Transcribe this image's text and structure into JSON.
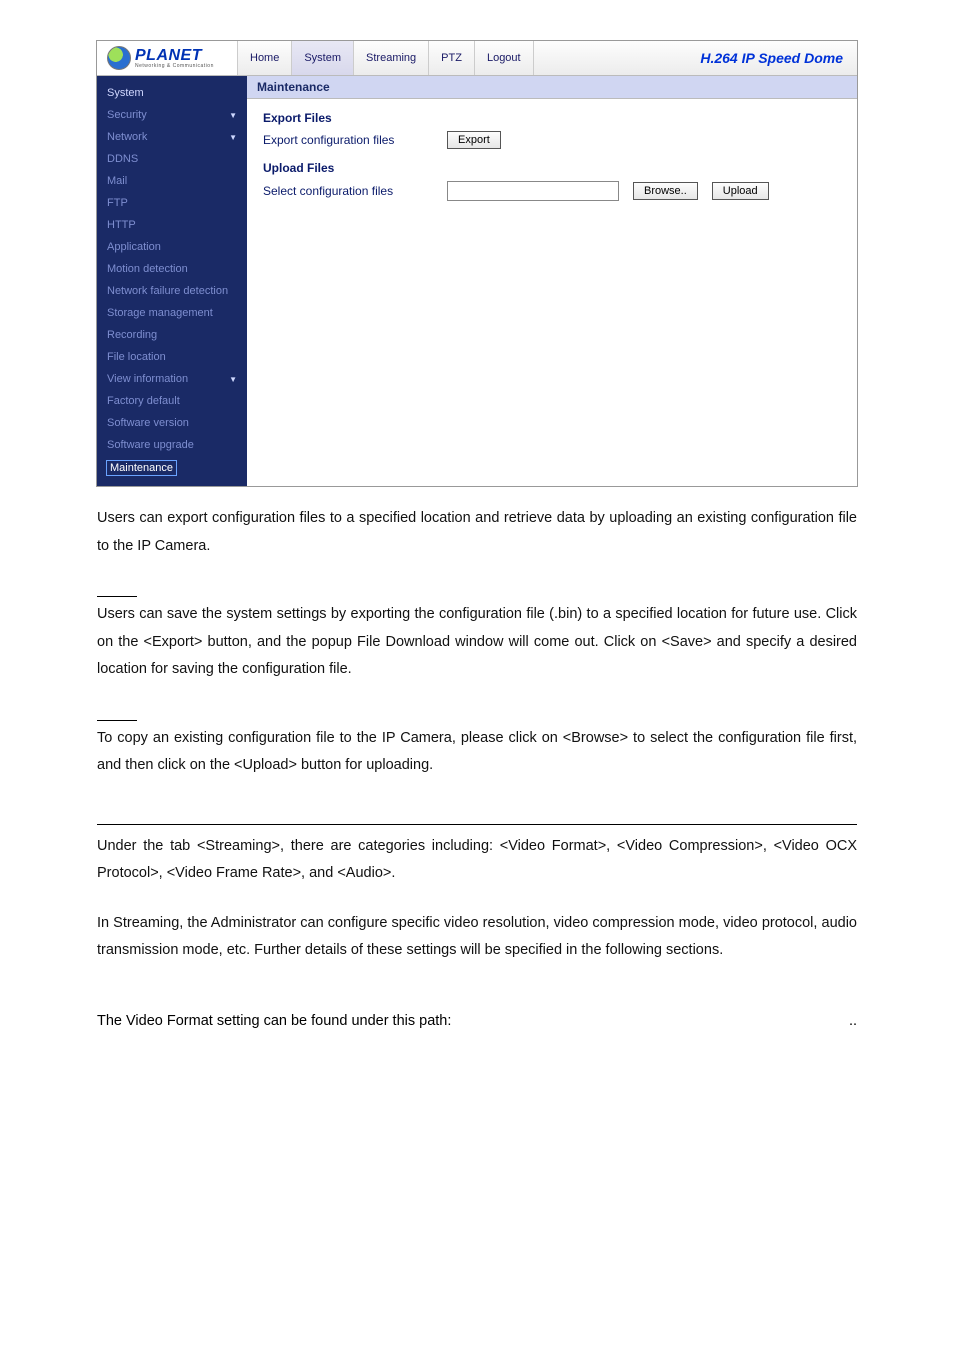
{
  "app": {
    "logo_text": "PLANET",
    "logo_sub": "Networking & Communication",
    "tabs": [
      "Home",
      "System",
      "Streaming",
      "PTZ",
      "Logout"
    ],
    "active_tab_index": 1,
    "brand_right": "H.264 IP Speed Dome"
  },
  "sidebar": {
    "items": [
      {
        "label": "System",
        "dim": false,
        "caret": false
      },
      {
        "label": "Security",
        "dim": true,
        "caret": true
      },
      {
        "label": "Network",
        "dim": true,
        "caret": true
      },
      {
        "label": "DDNS",
        "dim": true,
        "caret": false
      },
      {
        "label": "Mail",
        "dim": true,
        "caret": false
      },
      {
        "label": "FTP",
        "dim": true,
        "caret": false
      },
      {
        "label": "HTTP",
        "dim": true,
        "caret": false
      },
      {
        "label": "Application",
        "dim": true,
        "caret": false
      },
      {
        "label": "Motion detection",
        "dim": true,
        "caret": false
      },
      {
        "label": "Network failure detection",
        "dim": true,
        "caret": false
      },
      {
        "label": "Storage management",
        "dim": true,
        "caret": false
      },
      {
        "label": "Recording",
        "dim": true,
        "caret": false
      },
      {
        "label": "File location",
        "dim": true,
        "caret": false
      },
      {
        "label": "View information",
        "dim": true,
        "caret": true
      },
      {
        "label": "Factory default",
        "dim": true,
        "caret": false
      },
      {
        "label": "Software version",
        "dim": true,
        "caret": false
      },
      {
        "label": "Software upgrade",
        "dim": true,
        "caret": false
      },
      {
        "label": "Maintenance",
        "dim": false,
        "caret": false,
        "selected": true
      }
    ]
  },
  "content": {
    "page_title": "Maintenance",
    "export_title": "Export Files",
    "export_label": "Export configuration files",
    "export_btn": "Export",
    "upload_title": "Upload Files",
    "upload_label": "Select configuration files",
    "browse_btn": "Browse..",
    "upload_btn": "Upload"
  },
  "doc": {
    "p1": "Users can export configuration files to a specified location and retrieve data by uploading an existing configuration file to the IP Camera.",
    "p2": "Users can save the system settings by exporting the configuration file (.bin) to a specified location for future use. Click on the <Export> button, and the popup File Download window will come out. Click on <Save> and specify a desired location for saving the configuration file.",
    "p3": "To copy an existing configuration file to the IP Camera, please click on <Browse> to select the configuration file first, and then click on the <Upload> button for uploading.",
    "p4": "Under the tab <Streaming>, there are categories including: <Video Format>, <Video Compression>, <Video OCX Protocol>, <Video Frame Rate>, and <Audio>.",
    "p5": "In Streaming, the Administrator can configure specific video resolution, video compression mode, video protocol, audio transmission mode, etc. Further details of these settings will be specified in the following sections.",
    "footer_left": "The Video Format setting can be found under this path:",
    "footer_right": ".."
  }
}
